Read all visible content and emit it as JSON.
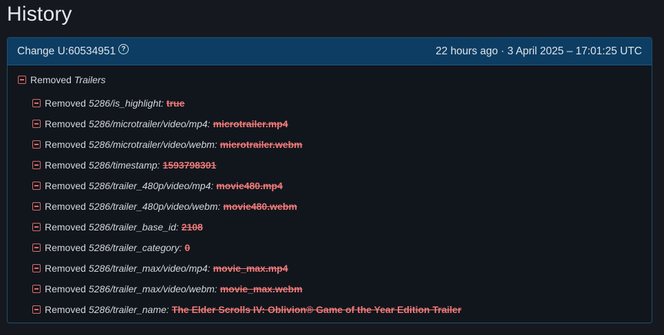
{
  "page": {
    "title": "History"
  },
  "change": {
    "id_label": "Change U:60534951",
    "timestamp": "22 hours ago · 3 April 2025 – 17:01:25 UTC",
    "help_glyph": "?"
  },
  "diff": {
    "section": {
      "verb": "Removed",
      "name": "Trailers"
    },
    "items": [
      {
        "verb": "Removed",
        "path": "5286/is_highlight:",
        "value": "true"
      },
      {
        "verb": "Removed",
        "path": "5286/microtrailer/video/mp4:",
        "value": "microtrailer.mp4"
      },
      {
        "verb": "Removed",
        "path": "5286/microtrailer/video/webm:",
        "value": "microtrailer.webm"
      },
      {
        "verb": "Removed",
        "path": "5286/timestamp:",
        "value": "1593798301"
      },
      {
        "verb": "Removed",
        "path": "5286/trailer_480p/video/mp4:",
        "value": "movie480.mp4"
      },
      {
        "verb": "Removed",
        "path": "5286/trailer_480p/video/webm:",
        "value": "movie480.webm"
      },
      {
        "verb": "Removed",
        "path": "5286/trailer_base_id:",
        "value": "2108"
      },
      {
        "verb": "Removed",
        "path": "5286/trailer_category:",
        "value": "0"
      },
      {
        "verb": "Removed",
        "path": "5286/trailer_max/video/mp4:",
        "value": "movie_max.mp4"
      },
      {
        "verb": "Removed",
        "path": "5286/trailer_max/video/webm:",
        "value": "movie_max.webm"
      },
      {
        "verb": "Removed",
        "path": "5286/trailer_name:",
        "value": "The Elder Scrolls IV: Oblivion® Game of the Year Edition Trailer"
      }
    ]
  },
  "colors": {
    "header_bg": "#0d3d62",
    "removed_red": "#f07a7a",
    "page_bg": "#15191f"
  },
  "icons": {
    "removed": "minus-square-icon",
    "help": "help-circle-icon"
  }
}
